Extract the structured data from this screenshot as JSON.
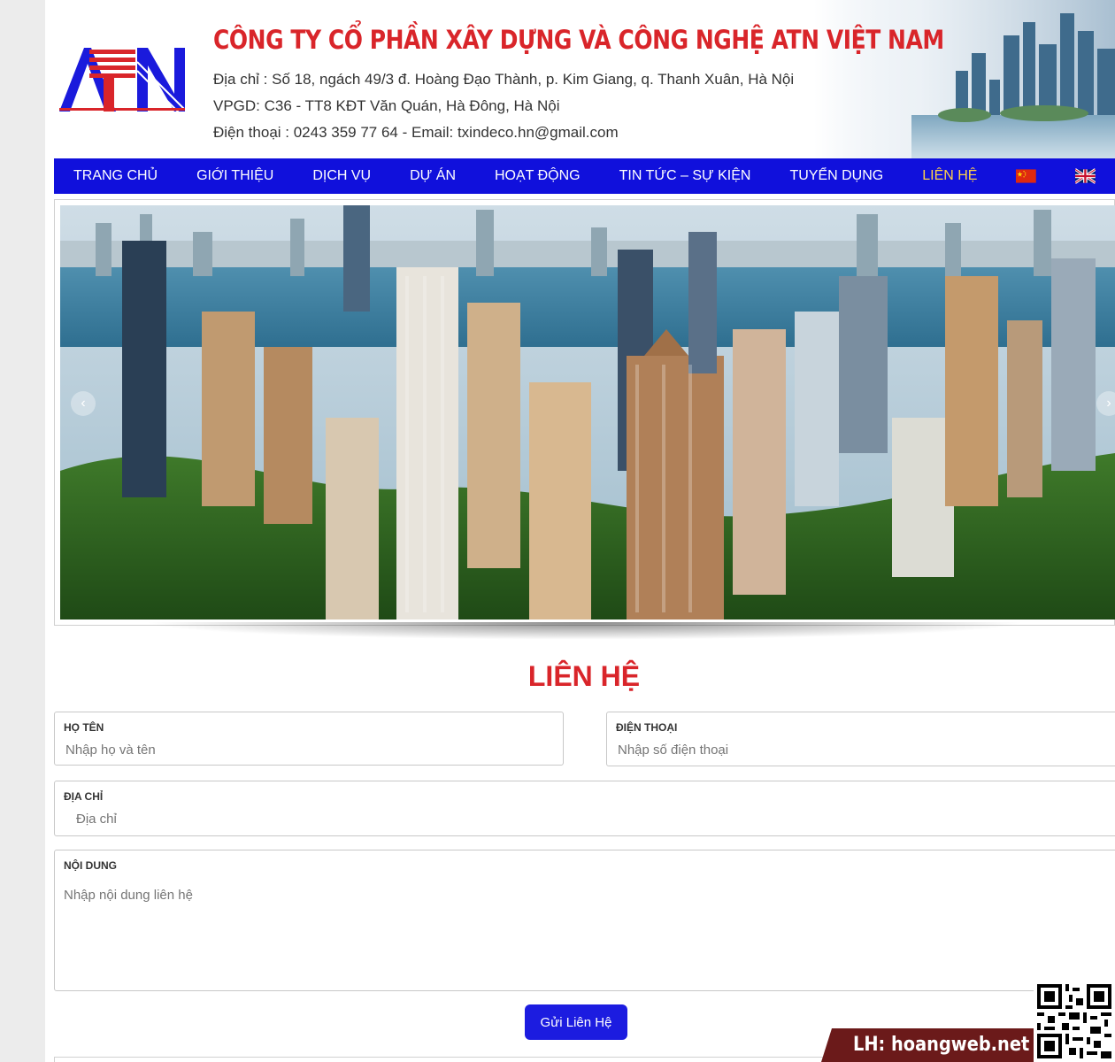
{
  "header": {
    "logo_text": "ATN",
    "company_name": "CÔNG TY CỔ PHẦN XÂY DỰNG VÀ CÔNG NGHỆ ATN VIỆT NAM",
    "address": "Địa chỉ : Số 18, ngách 49/3 đ. Hoàng Đạo Thành, p. Kim Giang, q. Thanh Xuân, Hà Nội",
    "office": "VPGD: C36 - TT8 KĐT Văn Quán, Hà Đông, Hà Nội",
    "contact": "Điện thoại : 0243 359 77 64 -  Email: txindeco.hn@gmail.com"
  },
  "nav": {
    "items": [
      "TRANG CHỦ",
      "GIỚI THIỆU",
      "DỊCH VỤ",
      "DỰ ÁN",
      "HOẠT ĐỘNG",
      "TIN TỨC – SỰ KIỆN",
      "TUYỂN DỤNG",
      "LIÊN HỆ"
    ],
    "active": "LIÊN HỆ",
    "flags": [
      "china-flag-icon",
      "uk-flag-icon"
    ],
    "bg_color": "#1010dc",
    "active_color": "#ffd24a"
  },
  "slider": {
    "prev_icon": "chevron-left-icon",
    "next_icon": "chevron-right-icon"
  },
  "contact": {
    "title": "LIÊN HỆ",
    "name_label": "HỌ TÊN",
    "name_placeholder": "Nhập họ và tên",
    "phone_label": "ĐIỆN THOẠI",
    "phone_placeholder": "Nhập số điện thoại",
    "address_label": "ĐỊA CHỈ",
    "address_placeholder": "Địa chỉ",
    "message_label": "NỘI DUNG",
    "message_placeholder": "Nhập nội dung liên hệ",
    "submit_label": "Gửi Liên Hệ",
    "accent_color": "#d9252a",
    "button_color": "#1c1ce0"
  },
  "watermark": {
    "text": "LH: hoangweb.net"
  }
}
